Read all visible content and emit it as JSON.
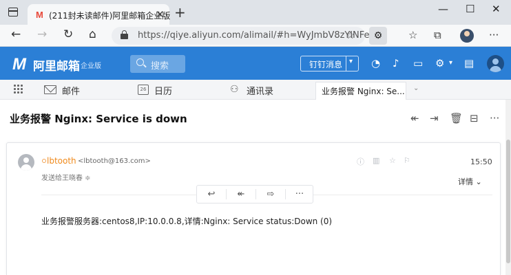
{
  "browser": {
    "tab_title": "(211封未读邮件)阿里邮箱企业版",
    "tab_favicon": "M",
    "tab_close": "✕",
    "new_tab": "+",
    "window_controls": {
      "minimize": "—",
      "maximize": "☐",
      "close": "✕"
    },
    "address": "https://qiye.aliyun.com/alimail/#h=WyJmbV8zYlNFe..."
  },
  "header": {
    "logo_mark": "M",
    "logo_text": "阿里邮箱",
    "logo_sub": "企业版",
    "search_placeholder": "搜索",
    "dingtalk_label": "钉钉消息",
    "dingtalk_caret": "▾"
  },
  "subnav": {
    "items": [
      {
        "label": "邮件"
      },
      {
        "label": "日历"
      },
      {
        "label": "通讯录"
      }
    ],
    "calendar_day": "26",
    "open_tab": "业务报警 Nginx: Se...",
    "open_tab_chevron": "⌄"
  },
  "message": {
    "subject": "业务报警 Nginx: Service is down",
    "sender_name": "lbtooth",
    "sender_email": "<lbtooth@163.com>",
    "recipient": "发送给王晓春 ≑",
    "time": "15:50",
    "details_label": "详情 ⌄",
    "body": "业务报警服务器:centos8,IP:10.0.0.8,详情:Nginx: Service status:Down (0)"
  }
}
